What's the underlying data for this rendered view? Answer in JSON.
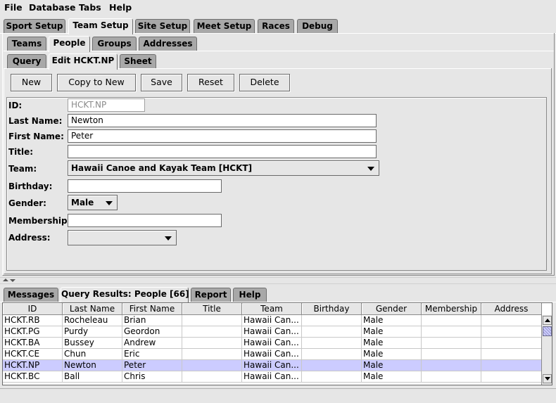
{
  "menu": [
    {
      "label": "File"
    },
    {
      "label": "Database"
    },
    {
      "label": "Tabs"
    },
    {
      "label": "Help"
    }
  ],
  "main_tabs": [
    {
      "label": "Sport Setup"
    },
    {
      "label": "Team Setup"
    },
    {
      "label": "Site Setup"
    },
    {
      "label": "Meet Setup"
    },
    {
      "label": "Races"
    },
    {
      "label": "Debug"
    }
  ],
  "sub_tabs": [
    {
      "label": "Teams"
    },
    {
      "label": "People"
    },
    {
      "label": "Groups"
    },
    {
      "label": "Addresses"
    }
  ],
  "inner_tabs": [
    {
      "label": "Query"
    },
    {
      "label": "Edit HCKT.NP"
    },
    {
      "label": "Sheet"
    }
  ],
  "toolbar": {
    "new": "New",
    "copy_to_new": "Copy to New",
    "save": "Save",
    "reset": "Reset",
    "delete": "Delete"
  },
  "form": {
    "id_label": "ID:",
    "id_value": "HCKT.NP",
    "last_name_label": "Last Name:",
    "last_name_value": "Newton",
    "first_name_label": "First Name:",
    "first_name_value": "Peter",
    "title_label": "Title:",
    "title_value": "",
    "team_label": "Team:",
    "team_value": "Hawaii Canoe and Kayak Team [HCKT]",
    "birthday_label": "Birthday:",
    "birthday_value": "",
    "gender_label": "Gender:",
    "gender_value": "Male",
    "membership_label": "Membership:",
    "membership_value": "",
    "address_label": "Address:",
    "address_value": ""
  },
  "bottom_tabs": [
    {
      "label": "Messages"
    },
    {
      "label": "Query Results: People [66]"
    },
    {
      "label": "Report"
    },
    {
      "label": "Help"
    }
  ],
  "table": {
    "columns": [
      "ID",
      "Last Name",
      "First Name",
      "Title",
      "Team",
      "Birthday",
      "Gender",
      "Membership",
      "Address"
    ],
    "rows": [
      [
        "HCKT.RB",
        "Rocheleau",
        "Brian",
        "",
        "Hawaii Can...",
        "",
        "Male",
        "",
        ""
      ],
      [
        "HCKT.PG",
        "Purdy",
        "Geordon",
        "",
        "Hawaii Can...",
        "",
        "Male",
        "",
        ""
      ],
      [
        "HCKT.BA",
        "Bussey",
        "Andrew",
        "",
        "Hawaii Can...",
        "",
        "Male",
        "",
        ""
      ],
      [
        "HCKT.CE",
        "Chun",
        "Eric",
        "",
        "Hawaii Can...",
        "",
        "Male",
        "",
        ""
      ],
      [
        "HCKT.NP",
        "Newton",
        "Peter",
        "",
        "Hawaii Can...",
        "",
        "Male",
        "",
        ""
      ],
      [
        "HCKT.BC",
        "Ball",
        "Chris",
        "",
        "Hawaii Can...",
        "",
        "Male",
        "",
        ""
      ]
    ],
    "selected_row": 4
  },
  "colors": {
    "background": "#e6e6e6",
    "inactive_tab": "#a8a8a8",
    "selection": "#ccccff"
  }
}
